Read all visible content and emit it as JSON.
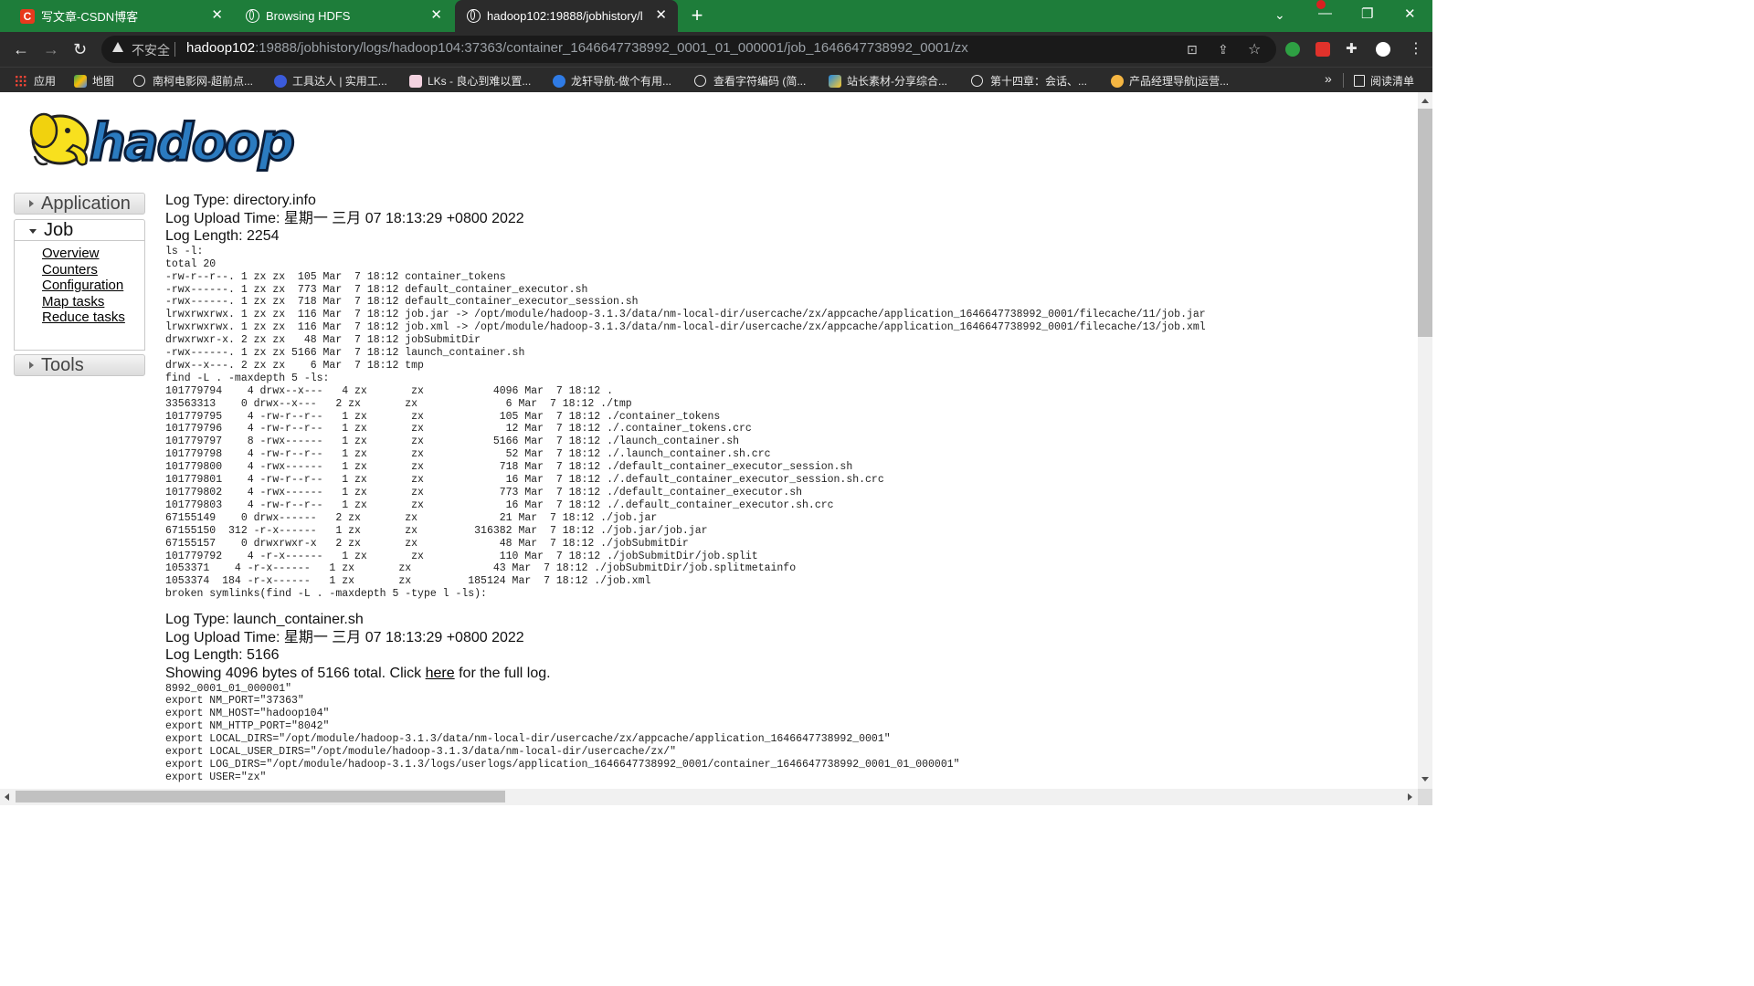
{
  "browser": {
    "tabs": [
      {
        "title": "写文章-CSDN博客",
        "icon": "csdn-icon"
      },
      {
        "title": "Browsing HDFS",
        "icon": "globe-icon"
      },
      {
        "title": "hadoop102:19888/jobhistory/l",
        "icon": "globe-icon"
      }
    ],
    "new_tab_label": "+",
    "security_label": "不安全",
    "url_host": "hadoop102",
    "url_rest": ":19888/jobhistory/logs/hadoop104:37363/container_1646647738992_0001_01_000001/job_1646647738992_0001/zx",
    "bookmarks": [
      {
        "label": "应用",
        "icon": "apps-grid-icon"
      },
      {
        "label": "地图",
        "icon": "maps-icon"
      },
      {
        "label": "南柯电影网-超前点...",
        "icon": "globe-icon"
      },
      {
        "label": "工具达人 | 实用工...",
        "icon": "tools-icon"
      },
      {
        "label": "LKs - 良心到难以置...",
        "icon": "lks-icon"
      },
      {
        "label": "龙轩导航-做个有用...",
        "icon": "nav-icon"
      },
      {
        "label": "查看字符编码 (简...",
        "icon": "globe-icon"
      },
      {
        "label": "站长素材-分享综合...",
        "icon": "sc-icon"
      },
      {
        "label": "第十四章：会话、...",
        "icon": "globe-icon"
      },
      {
        "label": "产品经理导航|运营...",
        "icon": "cat-icon"
      }
    ],
    "bookmarks_more": "»",
    "reading_list": "阅读清单"
  },
  "sidebar": {
    "application": "Application",
    "job": "Job",
    "job_links": [
      "Overview",
      "Counters",
      "Configuration",
      "Map tasks",
      "Reduce tasks"
    ],
    "tools": "Tools"
  },
  "logs": [
    {
      "type": "Log Type: directory.info",
      "upload": "Log Upload Time: 星期一 三月 07 18:13:29 +0800 2022",
      "length": "Log Length: 2254",
      "lines": [
        "ls -l:",
        "total 20",
        "-rw-r--r--. 1 zx zx  105 Mar  7 18:12 container_tokens",
        "-rwx------. 1 zx zx  773 Mar  7 18:12 default_container_executor.sh",
        "-rwx------. 1 zx zx  718 Mar  7 18:12 default_container_executor_session.sh",
        "lrwxrwxrwx. 1 zx zx  116 Mar  7 18:12 job.jar -> /opt/module/hadoop-3.1.3/data/nm-local-dir/usercache/zx/appcache/application_1646647738992_0001/filecache/11/job.jar",
        "lrwxrwxrwx. 1 zx zx  116 Mar  7 18:12 job.xml -> /opt/module/hadoop-3.1.3/data/nm-local-dir/usercache/zx/appcache/application_1646647738992_0001/filecache/13/job.xml",
        "drwxrwxr-x. 2 zx zx   48 Mar  7 18:12 jobSubmitDir",
        "-rwx------. 1 zx zx 5166 Mar  7 18:12 launch_container.sh",
        "drwx--x---. 2 zx zx    6 Mar  7 18:12 tmp",
        "find -L . -maxdepth 5 -ls:",
        "101779794    4 drwx--x---   4 zx       zx           4096 Mar  7 18:12 .",
        "33563313    0 drwx--x---   2 zx       zx              6 Mar  7 18:12 ./tmp",
        "101779795    4 -rw-r--r--   1 zx       zx            105 Mar  7 18:12 ./container_tokens",
        "101779796    4 -rw-r--r--   1 zx       zx             12 Mar  7 18:12 ./.container_tokens.crc",
        "101779797    8 -rwx------   1 zx       zx           5166 Mar  7 18:12 ./launch_container.sh",
        "101779798    4 -rw-r--r--   1 zx       zx             52 Mar  7 18:12 ./.launch_container.sh.crc",
        "101779800    4 -rwx------   1 zx       zx            718 Mar  7 18:12 ./default_container_executor_session.sh",
        "101779801    4 -rw-r--r--   1 zx       zx             16 Mar  7 18:12 ./.default_container_executor_session.sh.crc",
        "101779802    4 -rwx------   1 zx       zx            773 Mar  7 18:12 ./default_container_executor.sh",
        "101779803    4 -rw-r--r--   1 zx       zx             16 Mar  7 18:12 ./.default_container_executor.sh.crc",
        "67155149    0 drwx------   2 zx       zx             21 Mar  7 18:12 ./job.jar",
        "67155150  312 -r-x------   1 zx       zx         316382 Mar  7 18:12 ./job.jar/job.jar",
        "67155157    0 drwxrwxr-x   2 zx       zx             48 Mar  7 18:12 ./jobSubmitDir",
        "101779792    4 -r-x------   1 zx       zx            110 Mar  7 18:12 ./jobSubmitDir/job.split",
        "1053371    4 -r-x------   1 zx       zx             43 Mar  7 18:12 ./jobSubmitDir/job.splitmetainfo",
        "1053374  184 -r-x------   1 zx       zx         185124 Mar  7 18:12 ./job.xml",
        "broken symlinks(find -L . -maxdepth 5 -type l -ls):"
      ]
    },
    {
      "type": "Log Type: launch_container.sh",
      "upload": "Log Upload Time: 星期一 三月 07 18:13:29 +0800 2022",
      "length": "Log Length: 5166",
      "showing_prefix": "Showing 4096 bytes of 5166 total. Click ",
      "here_link": "here",
      "showing_suffix": " for the full log.",
      "lines": [
        "8992_0001_01_000001\"",
        "export NM_PORT=\"37363\"",
        "export NM_HOST=\"hadoop104\"",
        "export NM_HTTP_PORT=\"8042\"",
        "export LOCAL_DIRS=\"/opt/module/hadoop-3.1.3/data/nm-local-dir/usercache/zx/appcache/application_1646647738992_0001\"",
        "export LOCAL_USER_DIRS=\"/opt/module/hadoop-3.1.3/data/nm-local-dir/usercache/zx/\"",
        "export LOG_DIRS=\"/opt/module/hadoop-3.1.3/logs/userlogs/application_1646647738992_0001/container_1646647738992_0001_01_000001\"",
        "export USER=\"zx\""
      ]
    }
  ]
}
